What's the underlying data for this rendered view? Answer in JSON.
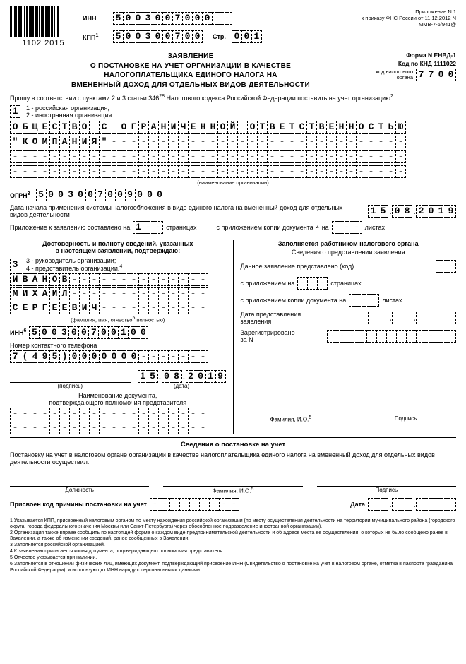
{
  "header": {
    "attachment": "Приложение N 1",
    "order_ref": "к приказу ФНС России от 11.12.2012 N ММВ-7-6/941@",
    "barcode_num": "1102 2015",
    "inn_label": "ИНН",
    "inn": "5003007000",
    "kpp_label": "КПП",
    "kpp_sup": "1",
    "kpp": "500300700",
    "page_label": "Стр.",
    "page": "001"
  },
  "title": {
    "line1": "ЗАЯВЛЕНИЕ",
    "line2": "О ПОСТАНОВКЕ НА УЧЕТ ОРГАНИЗАЦИИ В КАЧЕСТВЕ",
    "line3": "НАЛОГОПЛАТЕЛЬЩИКА ЕДИНОГО НАЛОГА НА",
    "line4": "ВМЕНЕННЫЙ ДОХОД ДЛЯ ОТДЕЛЬНЫХ ВИДОВ ДЕЯТЕЛЬНОСТИ",
    "form": "Форма N ЕНВД-1",
    "knd": "Код по КНД 1111022",
    "tax_code_label": "код налогового органа",
    "tax_code": "7700"
  },
  "intro": {
    "text": "Прошу в соответствии с пунктами 2 и 3 статьи 346",
    "sup": "28",
    "text2": " Налогового кодекса Российской Федерации поставить на учет организацию",
    "sup2": "2",
    "org_type": "1",
    "org_type_1": "1 - российская организация;",
    "org_type_2": "2 - иностранная организация.",
    "name_line1": "ОБЩЕСТВО С ОГРАНИЧЕННОЙ ОТВЕТСТВЕННОСТЬЮ",
    "name_line2": "\"КОМПАНИЯ\"",
    "name_caption": "(наименование организации)"
  },
  "ogrn": {
    "label": "ОГРН",
    "sup": "3",
    "value": "5003007009000"
  },
  "start_date": {
    "label": "Дата начала применения системы налогообложения в виде единого налога на вмененный доход для отдельных видов деятельности",
    "d": "15",
    "m": "08",
    "y": "2019"
  },
  "attach": {
    "text1": "Приложение к заявлению составлено на",
    "pages": "1",
    "pages_label": "страницах",
    "text2": "с приложением копии документа",
    "sup": "4",
    "on": "на",
    "sheets_label": "листах"
  },
  "confirm": {
    "heading1": "Достоверность и полноту сведений, указанных",
    "heading2": "в настоящем заявлении, подтверждаю:",
    "role_code": "3",
    "role3": "3 - руководитель организации;",
    "role4": "4 - представитель организации.",
    "role4_sup": "4",
    "last": "ИВАНОВ",
    "first": "МИХАИЛ",
    "patr": "СЕРГЕЕВИЧ",
    "fio_caption": "(фамилия, имя, отчество",
    "fio_sup": "5",
    "fio_caption2": " полностью)",
    "inn_label": "ИНН",
    "inn_sup": "6",
    "inn": "500300700100",
    "phone_label": "Номер контактного телефона",
    "phone": "7(495)0000000",
    "sign_label": "(подпись)",
    "date_label": "(дата)",
    "date_d": "15",
    "date_m": "08",
    "date_y": "2019",
    "doc_label1": "Наименование документа,",
    "doc_label2": "подтверждающего полномочия представителя"
  },
  "right_block": {
    "heading": "Заполняется работником налогового органа",
    "sub": "Сведения о представлении заявления",
    "line1": "Данное заявление представлено (код)",
    "line2a": "с приложением на",
    "line2b": "страницах",
    "line3a": "с приложением копии документа на",
    "line3b": "листах",
    "line4a": "Дата представления",
    "line4b": "заявления",
    "line5a": "Зарегистрировано",
    "line5b": "за N",
    "fio_label": "Фамилия, И.О.",
    "fio_sup": "5",
    "sign_label": "Подпись"
  },
  "registration": {
    "heading": "Сведения о постановке на учет",
    "text": "Постановку на учет в налоговом органе организации в качестве налогоплательщика единого налога на вмененный доход для отдельных видов деятельности осуществил:",
    "position": "Должность",
    "fio": "Фамилия, И.О.",
    "fio_sup": "5",
    "sign": "Подпись",
    "kpp_label": "Присвоен код причины постановки на учет",
    "date_label": "Дата"
  },
  "notes": {
    "n1": "1 Указывается КПП, присвоенный налоговым органом по месту нахождения российской организации (по месту осуществления деятельности на территории муниципального района (городского округа, города федерального значения Москвы или Санкт-Петербурга) через обособленное подразделение иностранной организации).",
    "n2": "2 Организация также вправе сообщить по настоящей форме о каждом виде предпринимательской деятельности и об адресе места ее осуществления, о которых не было сообщено ранее в Заявлении, а также об изменении сведений, ранее сообщенных в Заявлении.",
    "n3": "3 Заполняется российской организацией.",
    "n4": "4 К заявлению прилагается копия документа, подтверждающего полномочия представителя.",
    "n5": "5 Отчество указывается при наличии.",
    "n6": "6 Заполняется в отношении физических лиц, имеющих документ, подтверждающий присвоение ИНН (Свидетельство о постановке на учет в налоговом органе, отметка в паспорте гражданина Российской Федерации), и использующих ИНН наряду с персональными данными."
  }
}
